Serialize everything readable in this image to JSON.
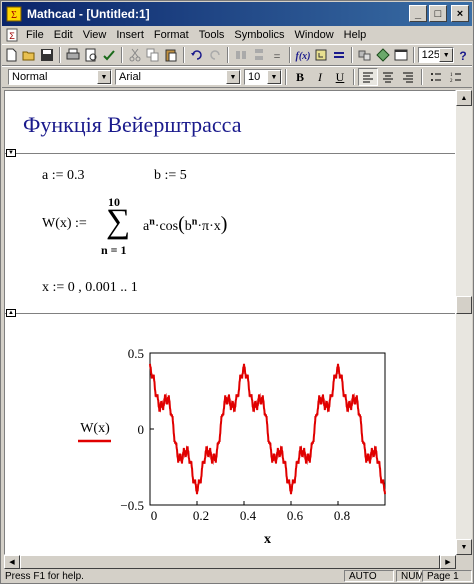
{
  "window": {
    "title": "Mathcad - [Untitled:1]",
    "buttons": {
      "minimize": "_",
      "maximize": "□",
      "close": "×"
    }
  },
  "menu": {
    "items": [
      "File",
      "Edit",
      "View",
      "Insert",
      "Format",
      "Tools",
      "Symbolics",
      "Window",
      "Help"
    ]
  },
  "toolbar": {
    "zoom": "125%"
  },
  "format": {
    "style": "Normal",
    "font": "Arial",
    "size": "10",
    "bold": "B",
    "italic": "I",
    "underline": "U"
  },
  "doc": {
    "heading": "Функція Вейерштрасса",
    "a_def": "a := 0.3",
    "b_def": "b := 5",
    "w_lhs": "W(x) :=",
    "sum_top": "10",
    "sum_bottom": "n = 1",
    "w_rhs_a": "a",
    "w_rhs_exp": "n",
    "w_rhs_cos": "·cos",
    "w_rhs_b": "b",
    "w_rhs_tail": "·π·x",
    "x_def": "x := 0 , 0.001 .. 1"
  },
  "chart_data": {
    "type": "line",
    "ylabel": "W(x)",
    "xlabel": "x",
    "xlim": [
      0,
      1
    ],
    "ylim": [
      -0.5,
      0.5
    ],
    "x_ticks": [
      "0",
      "0.2",
      "0.4",
      "0.6",
      "0.8"
    ],
    "y_ticks": [
      "0.5",
      "0",
      "−0.5"
    ],
    "series_color": "#e00000",
    "a": 0.3,
    "b": 5,
    "n_max": 10,
    "step": 0.001
  },
  "status": {
    "help": "Press F1 for help.",
    "auto": "AUTO",
    "num": "NUM",
    "page": "Page 1"
  }
}
